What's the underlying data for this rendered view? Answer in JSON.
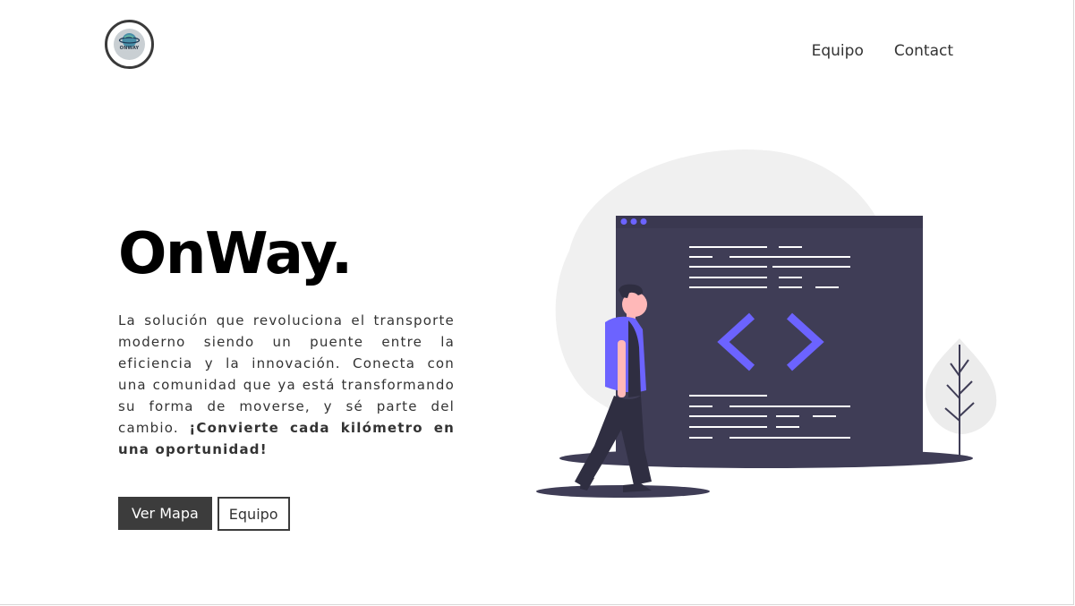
{
  "header": {
    "logo_text": "ONWAY",
    "nav": [
      {
        "label": "Equipo"
      },
      {
        "label": "Contact"
      }
    ]
  },
  "hero": {
    "title": "OnWay.",
    "description": "La solución que revoluciona el transporte moderno siendo un puente entre la eficiencia y la innovación. Conecta con una comunidad que ya está transformando su forma de moverse, y sé parte del cambio.",
    "description_bold": "¡Convierte cada kilómetro en una oportunidad!",
    "primary_button": "Ver Mapa",
    "secondary_button": "Equipo"
  },
  "colors": {
    "accent": "#6c63ff",
    "dark": "#3f3d56",
    "button_bg": "#3c3c3c"
  },
  "icons": {
    "logo": "globe-logo-icon",
    "illustration": "developer-code-window-illustration"
  }
}
